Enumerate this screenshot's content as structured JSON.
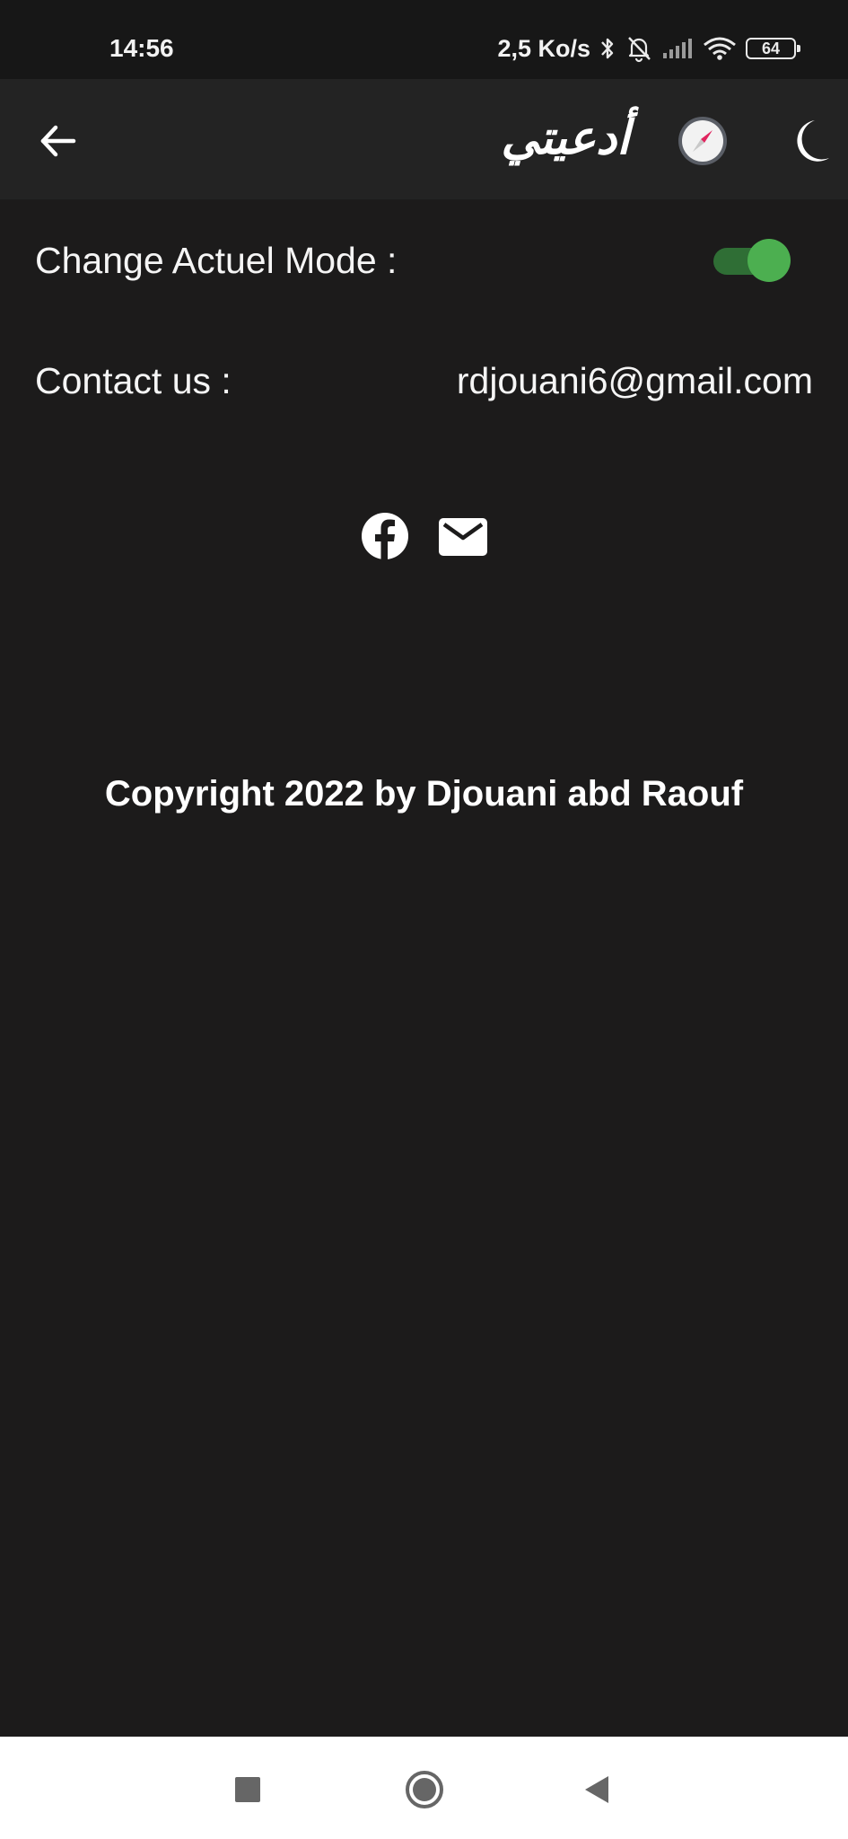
{
  "status_bar": {
    "time": "14:56",
    "net_speed": "2,5 Ko/s",
    "battery": "64",
    "icons": [
      "bluetooth-icon",
      "bell-off-icon",
      "signal-icon",
      "wifi-icon",
      "battery-icon"
    ]
  },
  "app_bar": {
    "title": "أدعيتي",
    "icons": [
      "back-arrow-icon",
      "compass-icon",
      "moon-icon"
    ]
  },
  "settings": {
    "mode_label": "Change Actuel Mode :",
    "mode_enabled": true,
    "contact_label": "Contact us :",
    "contact_email": "rdjouani6@gmail.com"
  },
  "social": {
    "icons": [
      "facebook-icon",
      "mail-icon"
    ]
  },
  "footer": {
    "copyright": "Copyright 2022 by Djouani abd Raouf"
  },
  "nav_bar": {
    "icons": [
      "recent-apps-icon",
      "home-icon",
      "back-icon"
    ]
  },
  "colors": {
    "background": "#1c1b1b",
    "app_bar": "#232323",
    "toggle_on": "#4caf50",
    "compass_needle": "#e0245e"
  }
}
